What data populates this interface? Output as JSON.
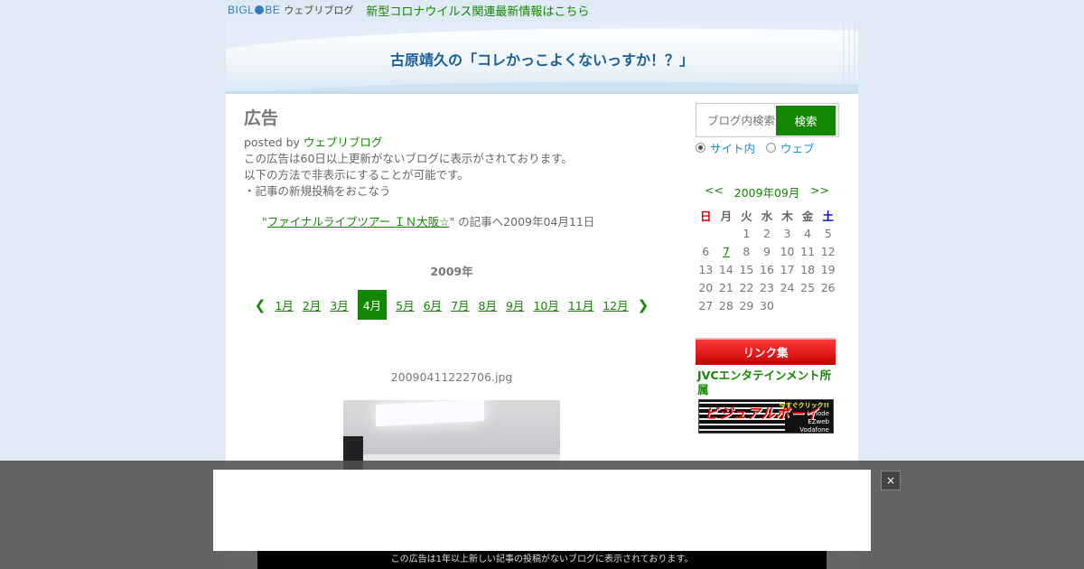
{
  "topbar": {
    "logo_text_a": "BIGL",
    "logo_text_b": "BE",
    "logo_sub": "ウェブリブログ",
    "news_link": "新型コロナウイルス関連最新情報はこちら"
  },
  "header": {
    "title": "古原靖久の「コレかっこよくないっすか！？」"
  },
  "main": {
    "heading": "広告",
    "posted_by_prefix": "posted by",
    "posted_by_link": "ウェブリブログ",
    "lines": [
      "この広告は60日以上更新がないブログに表示がされております。",
      "以下の方法で非表示にすることが可能です。",
      "・記事の新規投稿をおこなう"
    ],
    "article_quote_open": "\"",
    "article_link": "ファイナルライブツアー ＩＮ大阪☆",
    "article_suffix": "\" の記事へ2009年04月11日",
    "year_label": "2009年",
    "months": [
      "1月",
      "2月",
      "3月",
      "4月",
      "5月",
      "6月",
      "7月",
      "8月",
      "9月",
      "10月",
      "11月",
      "12月"
    ],
    "active_month": "4月",
    "image_filename": "20090411222706.jpg"
  },
  "sidebar": {
    "search_placeholder": "ブログ内検索",
    "search_button": "検索",
    "scope_site": "サイト内",
    "scope_web": "ウェブ",
    "calendar": {
      "prev": "<<",
      "month": "2009年09月",
      "next": ">>",
      "weekdays": [
        "日",
        "月",
        "火",
        "水",
        "木",
        "金",
        "土"
      ],
      "weeks": [
        [
          "",
          "",
          "1",
          "2",
          "3",
          "4",
          "5"
        ],
        [
          "6",
          "7",
          "8",
          "9",
          "10",
          "11",
          "12"
        ],
        [
          "13",
          "14",
          "15",
          "16",
          "17",
          "18",
          "19"
        ],
        [
          "20",
          "21",
          "22",
          "23",
          "24",
          "25",
          "26"
        ],
        [
          "27",
          "28",
          "29",
          "30",
          "",
          "",
          ""
        ]
      ],
      "linked_day": "7"
    },
    "links_heading": "リンク集",
    "link_item": "JVCエンタテインメント所属",
    "banner_text": "ビジュアルボーイ",
    "banner_right": [
      "今すぐクリック!!",
      "i-mode",
      "EZweb",
      "Vodafone"
    ]
  },
  "overlay": {
    "close_label": "×",
    "notice": "この広告は1年以上新しい記事の投稿がないブログに表示されております。"
  }
}
